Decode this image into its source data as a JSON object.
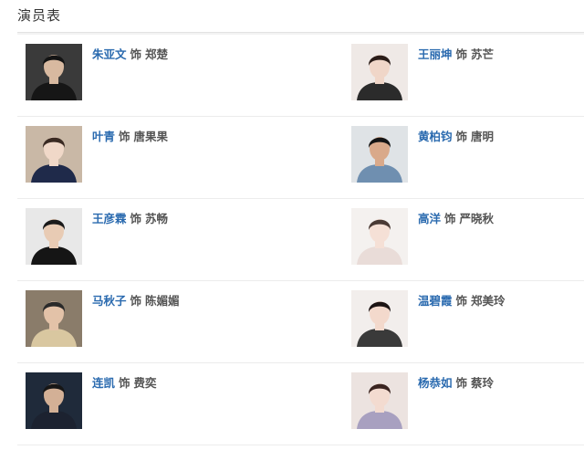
{
  "section": {
    "title": "演员表"
  },
  "cast": [
    {
      "actor": "朱亚文",
      "as": "饰",
      "role": "郑楚",
      "photo": {
        "bg": "#3a3a3a",
        "skin": "#d8b9a0",
        "hair": "#141414",
        "cloth": "#161616"
      }
    },
    {
      "actor": "王丽坤",
      "as": "饰",
      "role": "苏芒",
      "photo": {
        "bg": "#efe9e6",
        "skin": "#f0d6c8",
        "hair": "#2a1c18",
        "cloth": "#2b2b2b"
      }
    },
    {
      "actor": "叶青",
      "as": "饰",
      "role": "唐果果",
      "photo": {
        "bg": "#c9b8a6",
        "skin": "#f0d8c8",
        "hair": "#3a2a22",
        "cloth": "#1f2a4a"
      }
    },
    {
      "actor": "黄柏钧",
      "as": "饰",
      "role": "唐明",
      "photo": {
        "bg": "#dfe3e6",
        "skin": "#d9a98a",
        "hair": "#151515",
        "cloth": "#6f8fb0"
      }
    },
    {
      "actor": "王彦霖",
      "as": "饰",
      "role": "苏畅",
      "photo": {
        "bg": "#e8e8e8",
        "skin": "#e8cbb4",
        "hair": "#1a1a1a",
        "cloth": "#151515"
      }
    },
    {
      "actor": "高洋",
      "as": "饰",
      "role": "严晓秋",
      "photo": {
        "bg": "#f4f1ef",
        "skin": "#f5e0d6",
        "hair": "#4a3a35",
        "cloth": "#e9dcd8"
      }
    },
    {
      "actor": "马秋子",
      "as": "饰",
      "role": "陈媚媚",
      "photo": {
        "bg": "#8a7c6a",
        "skin": "#e3c2a8",
        "hair": "#2a2a2a",
        "cloth": "#d9c7a0"
      }
    },
    {
      "actor": "温碧霞",
      "as": "饰",
      "role": "郑美玲",
      "photo": {
        "bg": "#f2eeec",
        "skin": "#f3d9cc",
        "hair": "#1c1414",
        "cloth": "#3a3a3a"
      }
    },
    {
      "actor": "连凯",
      "as": "饰",
      "role": "费奕",
      "photo": {
        "bg": "#1f2a3a",
        "skin": "#d3b096",
        "hair": "#161616",
        "cloth": "#1c2230"
      }
    },
    {
      "actor": "杨恭如",
      "as": "饰",
      "role": "蔡玲",
      "photo": {
        "bg": "#ece3e0",
        "skin": "#f3dbd0",
        "hair": "#3a2420",
        "cloth": "#a8a0c0"
      }
    }
  ]
}
